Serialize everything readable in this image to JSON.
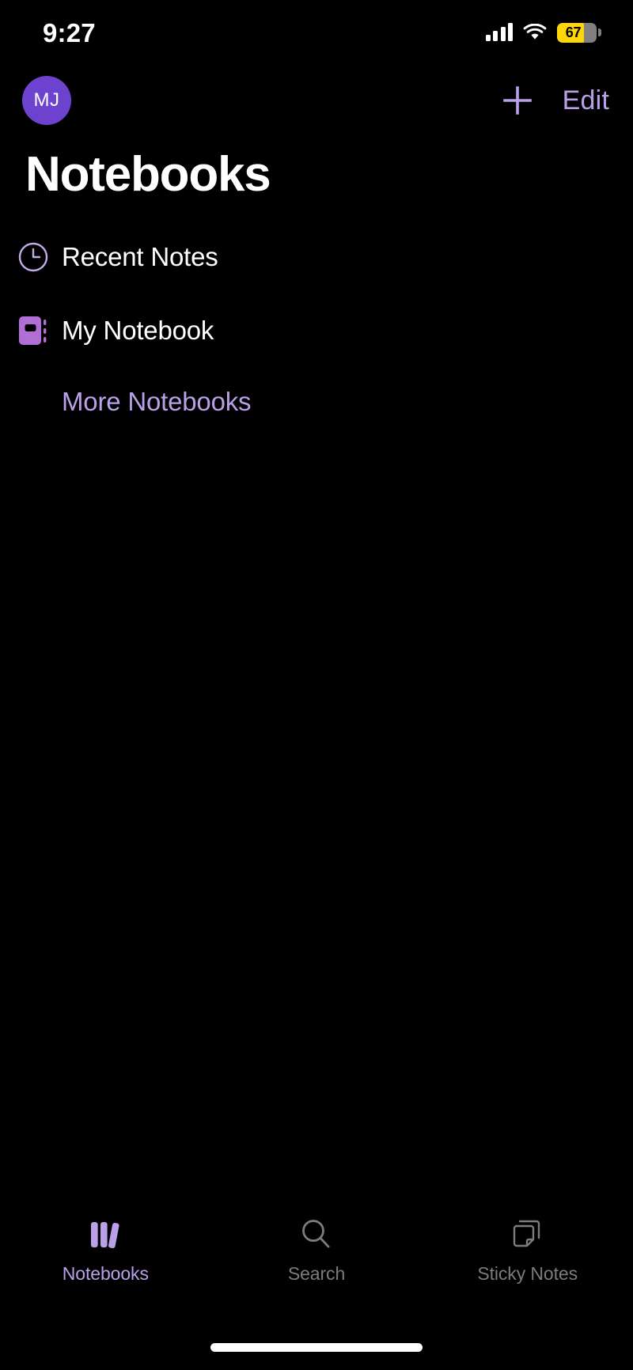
{
  "status_bar": {
    "time": "9:27",
    "cellular_icon": "cellular-bars-icon",
    "cellular_bars": 4,
    "wifi_icon": "wifi-icon",
    "battery_icon": "battery-icon",
    "battery_percent": "67",
    "battery_level": 67,
    "battery_color": "#ffd60a"
  },
  "nav_bar": {
    "avatar_initials": "MJ",
    "avatar_color": "#6c42cf",
    "add_icon": "plus-icon",
    "add_label": "+",
    "edit_label": "Edit",
    "accent_color": "#b9a0e8"
  },
  "header": {
    "title": "Notebooks"
  },
  "list": {
    "items": [
      {
        "label": "Recent Notes",
        "icon": "clock-icon"
      },
      {
        "label": "My Notebook",
        "icon": "notebook-icon"
      }
    ],
    "more_label": "More Notebooks"
  },
  "tab_bar": {
    "tabs": [
      {
        "label": "Notebooks",
        "icon": "books-icon",
        "active": true
      },
      {
        "label": "Search",
        "icon": "search-icon",
        "active": false
      },
      {
        "label": "Sticky Notes",
        "icon": "sticky-notes-icon",
        "active": false
      }
    ],
    "active_color": "#b9a0e8",
    "inactive_color": "#7c7c80"
  },
  "home_indicator": "home-indicator"
}
